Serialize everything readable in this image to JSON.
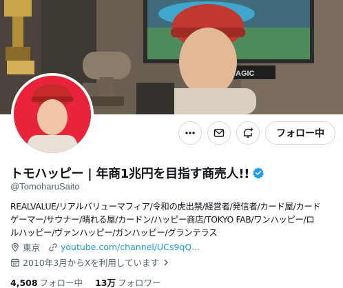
{
  "profile": {
    "display_name": "トモハッピー | 年商1兆円を目指す商売人!!",
    "handle": "@TomoharuSaito",
    "bio_lines": [
      "REALVALUE/リアルバリューマフィア/令和の虎出禁/経営者/発信者/カード屋/カード",
      "ゲーマー/サウナー/晴れる屋/カードン/ハッピー商店/TOKYO FAB/ワンハッピー/ロ",
      "ルハッピー/ヴァンハッピー/ガンハッピー/グランテラス"
    ],
    "location": "東京",
    "website": "youtube.com/channel/UCs9qQ...",
    "joined": "2010年3月からXを利用しています",
    "following_count": "4,508",
    "following_label": "フォロー中",
    "followers_count": "13万",
    "followers_label": "フォロワー"
  },
  "actions": {
    "more_icon": "more-icon",
    "message_icon": "envelope-icon",
    "subscribe_icon": "bell-plus-icon",
    "follow_label": "フォロー中"
  },
  "colors": {
    "link": "#1d9bf0",
    "verified": "#1d9bf0",
    "avatar_bg": "#e8233a",
    "secondary_text": "#536471"
  }
}
